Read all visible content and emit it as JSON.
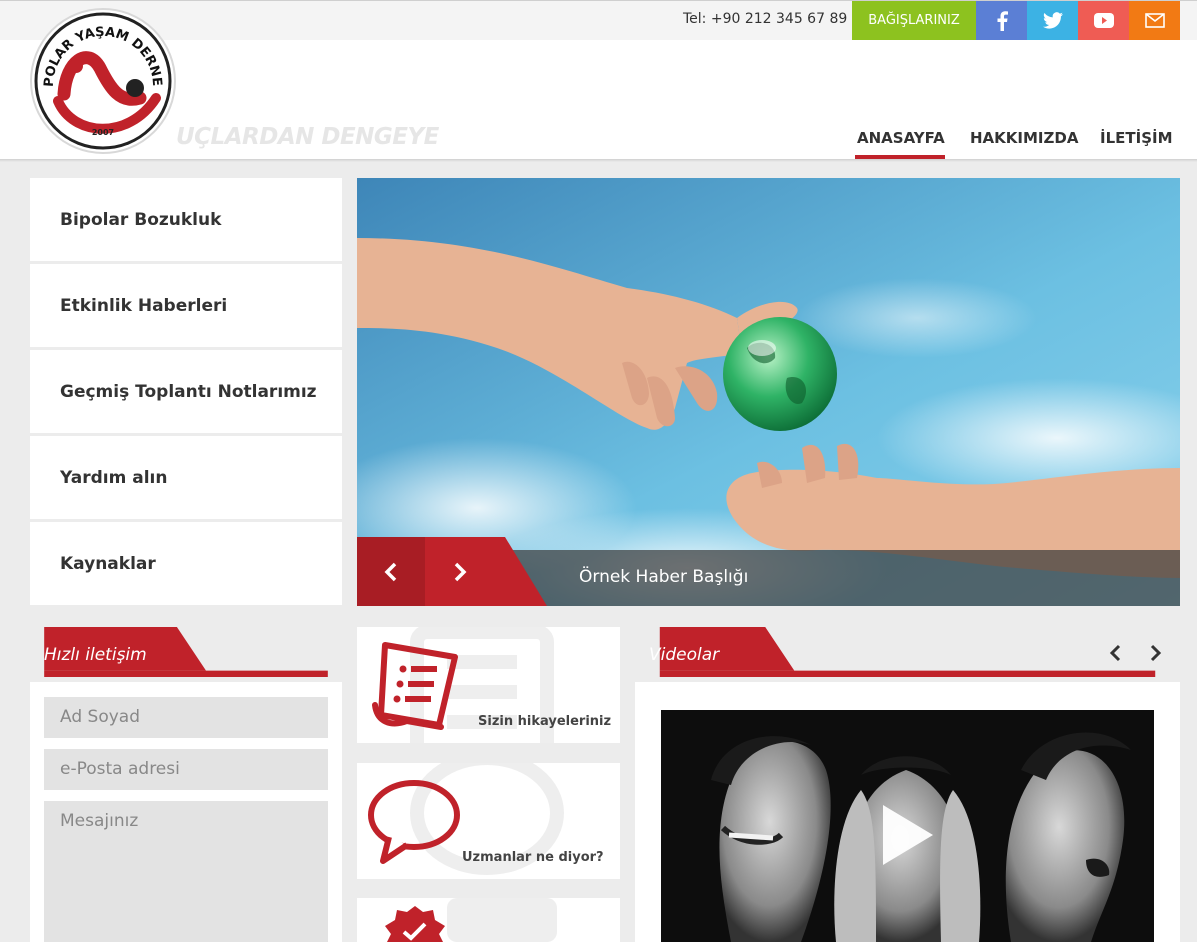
{
  "org": {
    "name": "BİPOLAR YAŞAM DERNEĞİ",
    "year": "2007",
    "slogan": "UÇLARDAN DENGEYE"
  },
  "topbar": {
    "phone": "Tel: +90 212 345 67 89",
    "donate_label": "BAĞIŞLARINIZ",
    "social": [
      {
        "icon": "facebook-icon",
        "color": "#5b7fd5"
      },
      {
        "icon": "twitter-icon",
        "color": "#3cb2e4"
      },
      {
        "icon": "youtube-icon",
        "color": "#ef5c54"
      },
      {
        "icon": "mail-icon",
        "color": "#f27a14"
      }
    ]
  },
  "nav": {
    "items": [
      "ANASAYFA",
      "HAKKIMIZDA",
      "İLETİŞİM"
    ],
    "active": "ANASAYFA"
  },
  "sidebar": {
    "items": [
      "Bipolar Bozukluk",
      "Etkinlik Haberleri",
      "Geçmiş Toplantı Notlarımız",
      "Yardım alın",
      "Kaynaklar"
    ]
  },
  "slider": {
    "caption": "Örnek Haber Başlığı"
  },
  "contact": {
    "title": "Hızlı iletişim",
    "name_placeholder": "Ad Soyad",
    "email_placeholder": "e-Posta adresi",
    "message_placeholder": "Mesajınız"
  },
  "tiles": [
    "Sizin hikayeleriniz",
    "Uzmanlar ne diyor?"
  ],
  "videos": {
    "title": "Videolar"
  },
  "colors": {
    "accent": "#c0222a",
    "green": "#8dc21f",
    "background": "#ececec"
  }
}
